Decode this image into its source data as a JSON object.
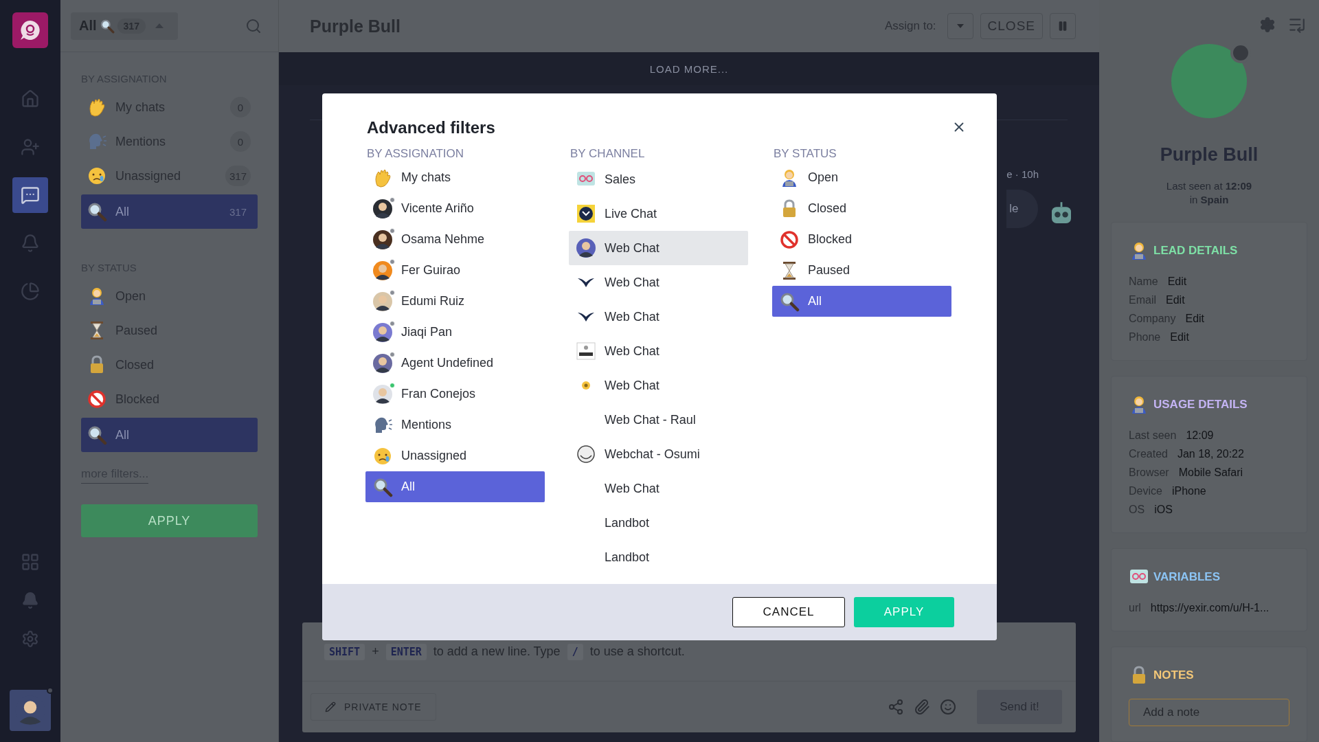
{
  "rail": {
    "items": [
      {
        "selected": false
      },
      {
        "selected": false
      },
      {
        "selected": true
      },
      {
        "selected": false
      },
      {
        "selected": false
      }
    ]
  },
  "filter_bar": {
    "label": "All",
    "count": "317"
  },
  "sidebar": {
    "sections": [
      {
        "heading": "BY ASSIGNATION",
        "items": [
          {
            "label": "My chats",
            "count": "0",
            "selected": false
          },
          {
            "label": "Mentions",
            "count": "0",
            "selected": false
          },
          {
            "label": "Unassigned",
            "count": "317",
            "selected": false
          },
          {
            "label": "All",
            "count": "317",
            "selected": true
          }
        ]
      },
      {
        "heading": "BY STATUS",
        "items": [
          {
            "label": "Open",
            "selected": false
          },
          {
            "label": "Paused",
            "selected": false
          },
          {
            "label": "Closed",
            "selected": false
          },
          {
            "label": "Blocked",
            "selected": false
          },
          {
            "label": "All",
            "selected": true
          }
        ]
      }
    ],
    "more_filters": "more filters...",
    "apply": "APPLY"
  },
  "header": {
    "title": "Purple Bull",
    "assign_label": "Assign to:",
    "close": "CLOSE"
  },
  "chat": {
    "load_more": "LOAD MORE...",
    "meta_fragment": "e · 10h",
    "bubble_fragment": "le"
  },
  "composer": {
    "hint": [
      {
        "kind": "key",
        "text": "SHIFT"
      },
      {
        "kind": "text",
        "text": "+"
      },
      {
        "kind": "key",
        "text": "ENTER"
      },
      {
        "kind": "text",
        "text": "to add a new line. Type"
      },
      {
        "kind": "key",
        "text": "/"
      },
      {
        "kind": "text",
        "text": "to use a shortcut."
      }
    ],
    "private_note": "PRIVATE NOTE",
    "send": "Send it!"
  },
  "contact": {
    "name": "Purple Bull",
    "online": false,
    "last_seen": "Last seen at **12:09**",
    "location": "in **Spain**",
    "sections": [
      {
        "title": "LEAD DETAILS",
        "color": "#7ee0a6",
        "rows": [
          {
            "label": "Name",
            "value": "Edit"
          },
          {
            "label": "Email",
            "value": "Edit"
          },
          {
            "label": "Company",
            "value": "Edit"
          },
          {
            "label": "Phone",
            "value": "Edit"
          }
        ]
      },
      {
        "title": "USAGE DETAILS",
        "color": "#c4b4f4",
        "rows": [
          {
            "label": "Last seen",
            "value": "12:09"
          },
          {
            "label": "Created",
            "value": "Jan 18, 20:22"
          },
          {
            "label": "Browser",
            "value": "Mobile Safari"
          },
          {
            "label": "Device",
            "value": "iPhone"
          },
          {
            "label": "OS",
            "value": "iOS"
          }
        ]
      },
      {
        "title": "VARIABLES",
        "color": "#8cc4f4",
        "rows": [
          {
            "label": "url",
            "value": "https://yexir.com/u/H-1..."
          }
        ]
      },
      {
        "title": "NOTES",
        "color": "#f4c878",
        "placeholder": "Add a note"
      }
    ]
  },
  "modal": {
    "title": "Advanced filters",
    "columns": [
      {
        "heading": "BY ASSIGNATION",
        "items": [
          {
            "label": "My chats",
            "selected": false
          },
          {
            "label": "Vicente Ariño",
            "selected": false,
            "online": false
          },
          {
            "label": "Osama Nehme",
            "selected": false,
            "online": false
          },
          {
            "label": "Fer Guirao",
            "selected": false,
            "online": false
          },
          {
            "label": "Edumi Ruiz",
            "selected": false,
            "online": false
          },
          {
            "label": "Jiaqi Pan",
            "selected": false,
            "online": false
          },
          {
            "label": "Agent Undefined",
            "selected": false,
            "online": false
          },
          {
            "label": "Fran Conejos",
            "selected": false,
            "online": true
          },
          {
            "label": "Mentions",
            "selected": false
          },
          {
            "label": "Unassigned",
            "selected": false
          },
          {
            "label": "All",
            "selected": true
          }
        ]
      },
      {
        "heading": "BY CHANNEL",
        "items": [
          {
            "label": "Sales",
            "selected": false,
            "hovered": false
          },
          {
            "label": "Live Chat",
            "selected": false,
            "hovered": false
          },
          {
            "label": "Web Chat",
            "selected": false,
            "hovered": true
          },
          {
            "label": "Web Chat",
            "selected": false,
            "hovered": false
          },
          {
            "label": "Web Chat",
            "selected": false,
            "hovered": false
          },
          {
            "label": "Web Chat",
            "selected": false,
            "hovered": false
          },
          {
            "label": "Web Chat",
            "selected": false,
            "hovered": false
          },
          {
            "label": "Web Chat - Raul",
            "selected": false,
            "hovered": false
          },
          {
            "label": "Webchat - Osumi",
            "selected": false,
            "hovered": false
          },
          {
            "label": "Web Chat",
            "selected": false,
            "hovered": false
          },
          {
            "label": "Landbot",
            "selected": false,
            "hovered": false
          },
          {
            "label": "Landbot",
            "selected": false,
            "hovered": false
          }
        ]
      },
      {
        "heading": "BY STATUS",
        "items": [
          {
            "label": "Open",
            "selected": false
          },
          {
            "label": "Closed",
            "selected": false
          },
          {
            "label": "Blocked",
            "selected": false
          },
          {
            "label": "Paused",
            "selected": false
          },
          {
            "label": "All",
            "selected": true
          }
        ]
      }
    ],
    "cancel": "CANCEL",
    "apply": "APPLY"
  }
}
